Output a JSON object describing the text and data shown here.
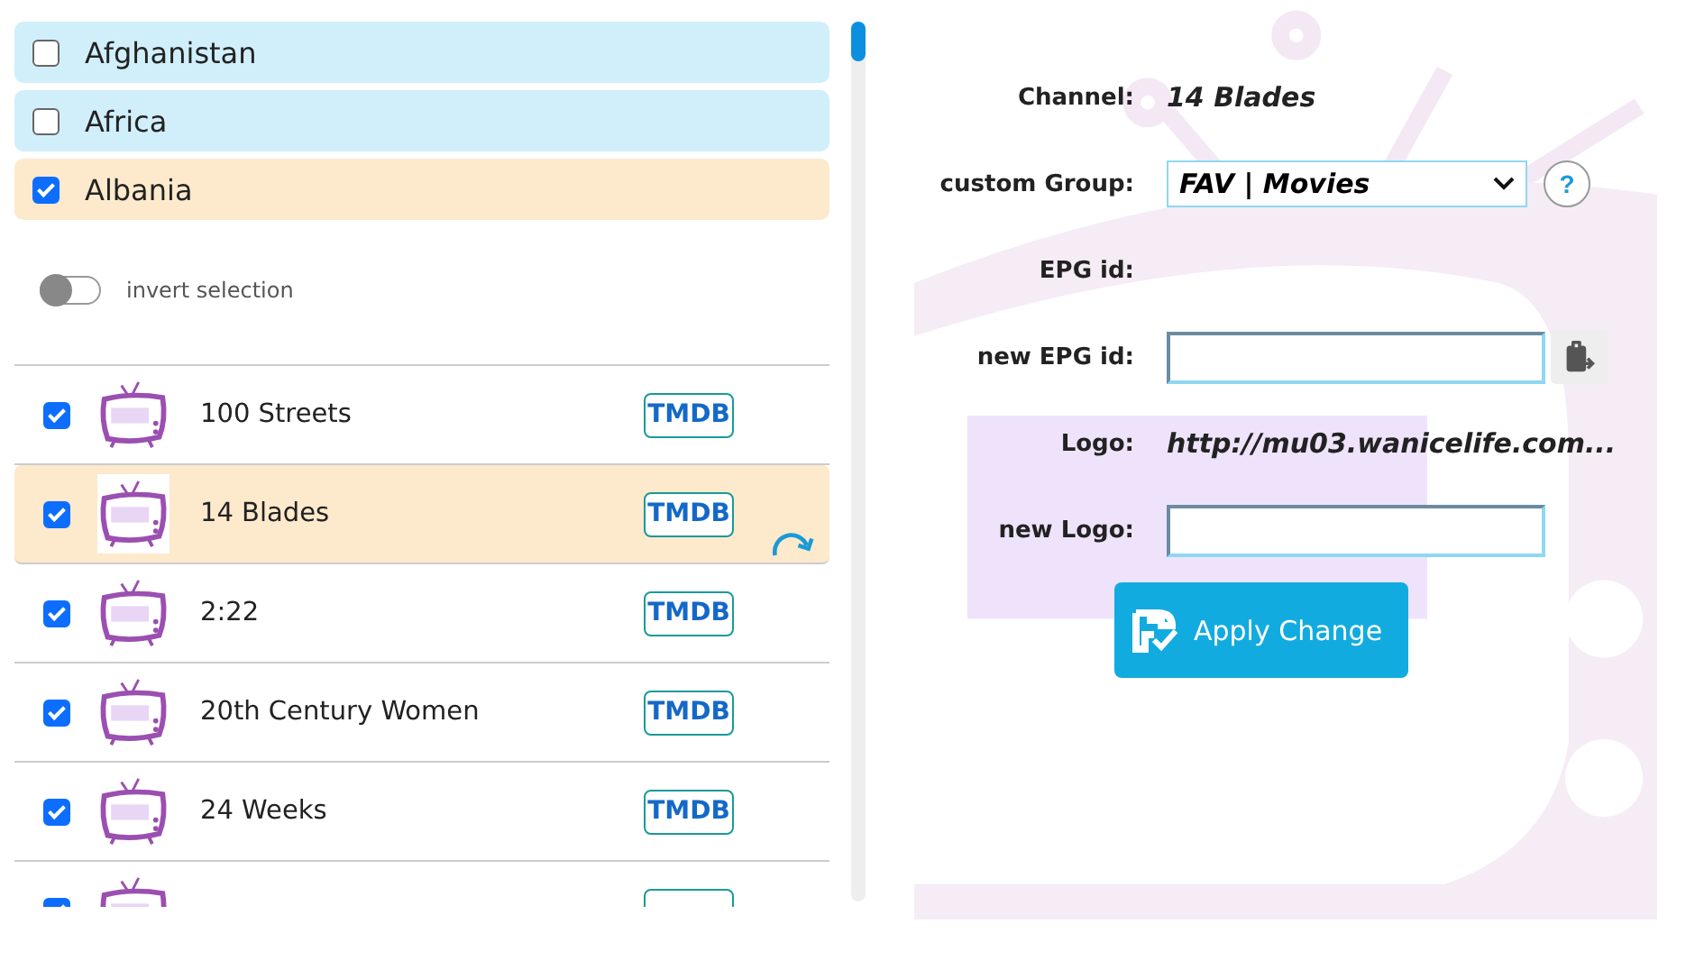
{
  "groups": [
    {
      "name": "Afghanistan",
      "checked": false,
      "selected": false
    },
    {
      "name": "Africa",
      "checked": false,
      "selected": false
    },
    {
      "name": "Albania",
      "checked": true,
      "selected": true
    }
  ],
  "invert": {
    "label": "invert selection",
    "on": false
  },
  "channels": [
    {
      "title": "100 Streets",
      "checked": true,
      "selected": false,
      "tmdb": "TMDB"
    },
    {
      "title": "14 Blades",
      "checked": true,
      "selected": true,
      "tmdb": "TMDB"
    },
    {
      "title": "2:22",
      "checked": true,
      "selected": false,
      "tmdb": "TMDB"
    },
    {
      "title": "20th Century Women",
      "checked": true,
      "selected": false,
      "tmdb": "TMDB"
    },
    {
      "title": "24 Weeks",
      "checked": true,
      "selected": false,
      "tmdb": "TMDB"
    },
    {
      "checked": true,
      "selected": false
    }
  ],
  "form": {
    "channel_label": "Channel:",
    "channel": "14 Blades",
    "group_label": "custom Group:",
    "group": "FAV | Movies",
    "help": "?",
    "epg_label": "EPG id:",
    "new_epg_label": "new EPG id:",
    "logo_label": "Logo:",
    "logo": "http://mu03.wanicelife.com...",
    "new_logo_label": "new Logo:",
    "apply": "Apply Change"
  }
}
